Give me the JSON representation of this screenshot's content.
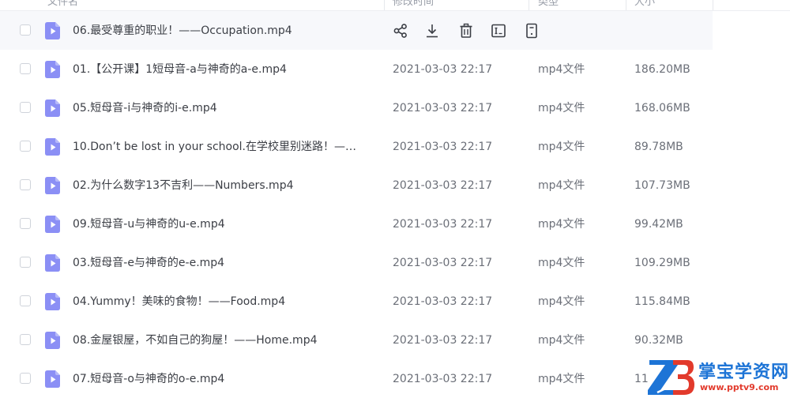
{
  "header": {
    "col_name": "文件名",
    "col_date": "修改时间",
    "col_type": "类型",
    "col_size": "大小"
  },
  "actions": {
    "share": "share-icon",
    "download": "download-icon",
    "delete": "trash-icon",
    "rename": "rename-icon",
    "more": "more-icon"
  },
  "files": [
    {
      "name": "06.最受尊重的职业！——Occupation.mp4",
      "date": "",
      "type": "",
      "size": ""
    },
    {
      "name": "01.【公开课】1短母音-a与神奇的a-e.mp4",
      "date": "2021-03-03 22:17",
      "type": "mp4文件",
      "size": "186.20MB"
    },
    {
      "name": "05.短母音-i与神奇的i-e.mp4",
      "date": "2021-03-03 22:17",
      "type": "mp4文件",
      "size": "168.06MB"
    },
    {
      "name": "10.Don’t be lost in your school.在学校里别迷路！—…",
      "date": "2021-03-03 22:17",
      "type": "mp4文件",
      "size": "89.78MB"
    },
    {
      "name": "02.为什么数字13不吉利——Numbers.mp4",
      "date": "2021-03-03 22:17",
      "type": "mp4文件",
      "size": "107.73MB"
    },
    {
      "name": "09.短母音-u与神奇的u-e.mp4",
      "date": "2021-03-03 22:17",
      "type": "mp4文件",
      "size": "99.42MB"
    },
    {
      "name": "03.短母音-e与神奇的e-e.mp4",
      "date": "2021-03-03 22:17",
      "type": "mp4文件",
      "size": "109.29MB"
    },
    {
      "name": "04.Yummy！美味的食物！——Food.mp4",
      "date": "2021-03-03 22:17",
      "type": "mp4文件",
      "size": "115.84MB"
    },
    {
      "name": "08.金屋银屋，不如自己的狗屋！——Home.mp4",
      "date": "2021-03-03 22:17",
      "type": "mp4文件",
      "size": "90.32MB"
    },
    {
      "name": "07.短母音-o与神奇的o-e.mp4",
      "date": "2021-03-03 22:17",
      "type": "mp4文件",
      "size": "11"
    }
  ],
  "watermark": {
    "title": "掌宝学资网",
    "url": "www.pptv9.com"
  },
  "colors": {
    "file_icon": "#8b8ff5",
    "hover_row": "#f7f8fb",
    "watermark_blue": "#1d74d6",
    "watermark_red": "#e23a2c"
  }
}
